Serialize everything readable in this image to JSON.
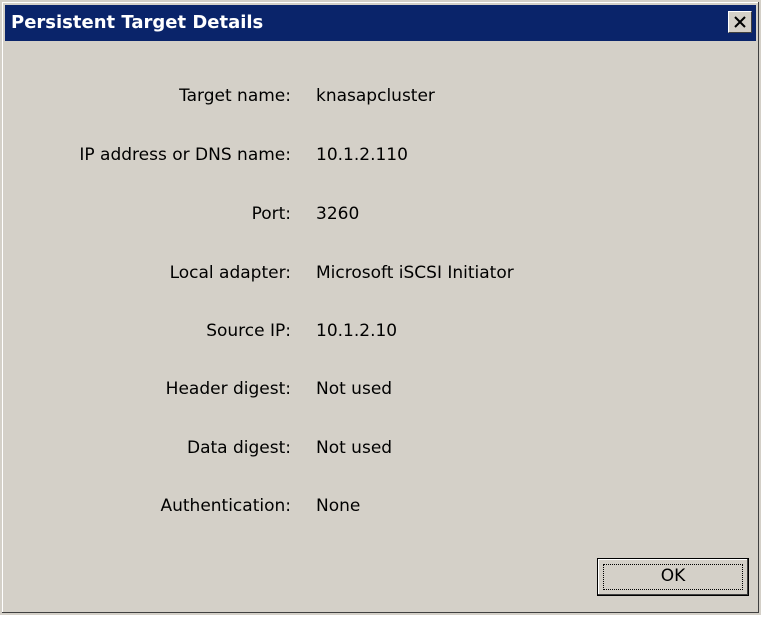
{
  "window": {
    "title": "Persistent Target Details",
    "close_glyph": "×",
    "icon_names": [
      "close-icon"
    ]
  },
  "details": [
    {
      "label": "Target name:",
      "value": "knasapcluster"
    },
    {
      "label": "IP address or DNS name:",
      "value": "10.1.2.110"
    },
    {
      "label": "Port:",
      "value": "3260"
    },
    {
      "label": "Local adapter:",
      "value": "Microsoft iSCSI Initiator"
    },
    {
      "label": "Source IP:",
      "value": "10.1.2.10"
    },
    {
      "label": "Header digest:",
      "value": "Not used"
    },
    {
      "label": "Data digest:",
      "value": "Not used"
    },
    {
      "label": "Authentication:",
      "value": "None"
    }
  ],
  "buttons": {
    "ok_label": "OK"
  },
  "colors": {
    "titlebar": "#0a246a",
    "dialog_face": "#d4d0c8",
    "title_text": "#ffffff"
  }
}
